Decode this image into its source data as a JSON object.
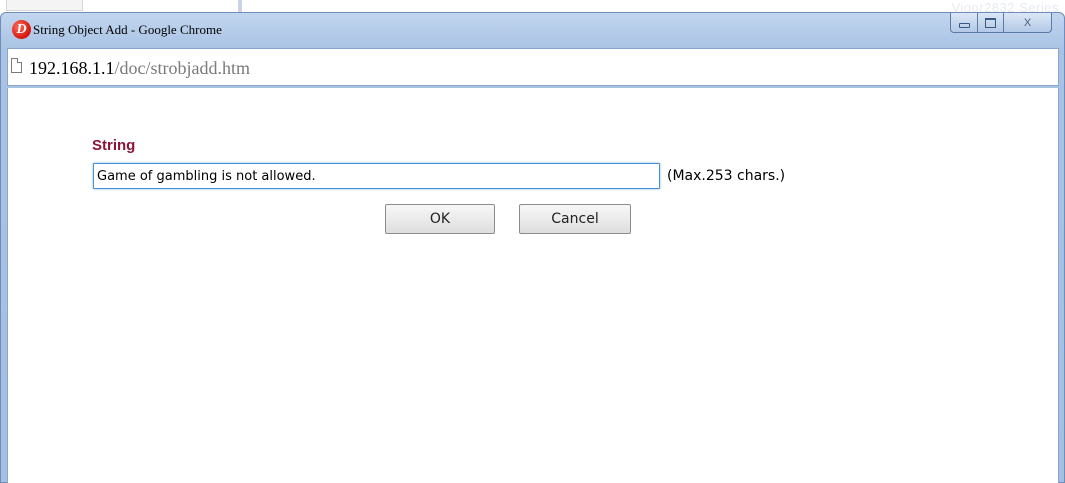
{
  "window": {
    "title": "String Object Add - Google Chrome",
    "app_icon": "D",
    "controls": {
      "close_glyph": "X"
    }
  },
  "address_bar": {
    "host": "192.168.1.1",
    "path": "/doc/strobjadd.htm"
  },
  "background": {
    "text": "Vigor2832 Series"
  },
  "form": {
    "label": "String",
    "input_value": "Game of gambling is not allowed.",
    "hint": "(Max.253 chars.)",
    "ok_label": "OK",
    "cancel_label": "Cancel"
  }
}
